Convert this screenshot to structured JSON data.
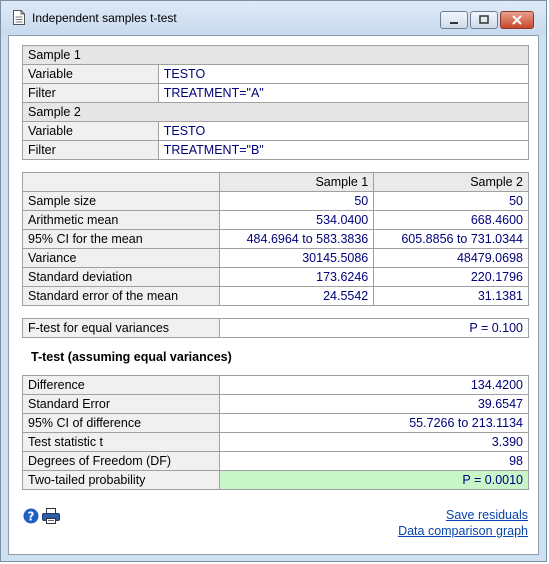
{
  "window": {
    "title": "Independent samples t-test"
  },
  "samples": {
    "sample1": {
      "header": "Sample 1",
      "variable_label": "Variable",
      "variable": "TESTO",
      "filter_label": "Filter",
      "filter": "TREATMENT=\"A\""
    },
    "sample2": {
      "header": "Sample 2",
      "variable_label": "Variable",
      "variable": "TESTO",
      "filter_label": "Filter",
      "filter": "TREATMENT=\"B\""
    }
  },
  "stats": {
    "columns": [
      "Sample 1",
      "Sample 2"
    ],
    "rows": [
      {
        "label": "Sample size",
        "s1": "50",
        "s2": "50"
      },
      {
        "label": "Arithmetic mean",
        "s1": "534.0400",
        "s2": "668.4600"
      },
      {
        "label": "95% CI for the mean",
        "s1": "484.6964 to 583.3836",
        "s2": "605.8856 to 731.0344"
      },
      {
        "label": "Variance",
        "s1": "30145.5086",
        "s2": "48479.0698"
      },
      {
        "label": "Standard deviation",
        "s1": "173.6246",
        "s2": "220.1796"
      },
      {
        "label": "Standard error of the mean",
        "s1": "24.5542",
        "s2": "31.1381"
      }
    ]
  },
  "ftest": {
    "label": "F-test for equal variances",
    "value": "P = 0.100"
  },
  "ttest": {
    "title": "T-test (assuming equal variances)",
    "rows": [
      {
        "label": "Difference",
        "value": "134.4200"
      },
      {
        "label": "Standard Error",
        "value": "39.6547"
      },
      {
        "label": "95% CI of difference",
        "value": "55.7266 to 213.1134"
      },
      {
        "label": "Test statistic t",
        "value": "3.390"
      },
      {
        "label": "Degrees of Freedom (DF)",
        "value": "98"
      },
      {
        "label": "Two-tailed probability",
        "value": "P = 0.0010"
      }
    ]
  },
  "footer": {
    "icons": [
      "help-icon",
      "print-icon"
    ],
    "links": {
      "save_residuals": "Save residuals",
      "comparison_graph": "Data comparison graph"
    }
  },
  "colors": {
    "significant_highlight": "#c8f6c8",
    "value_text": "#00007a",
    "link": "#0645ad"
  }
}
